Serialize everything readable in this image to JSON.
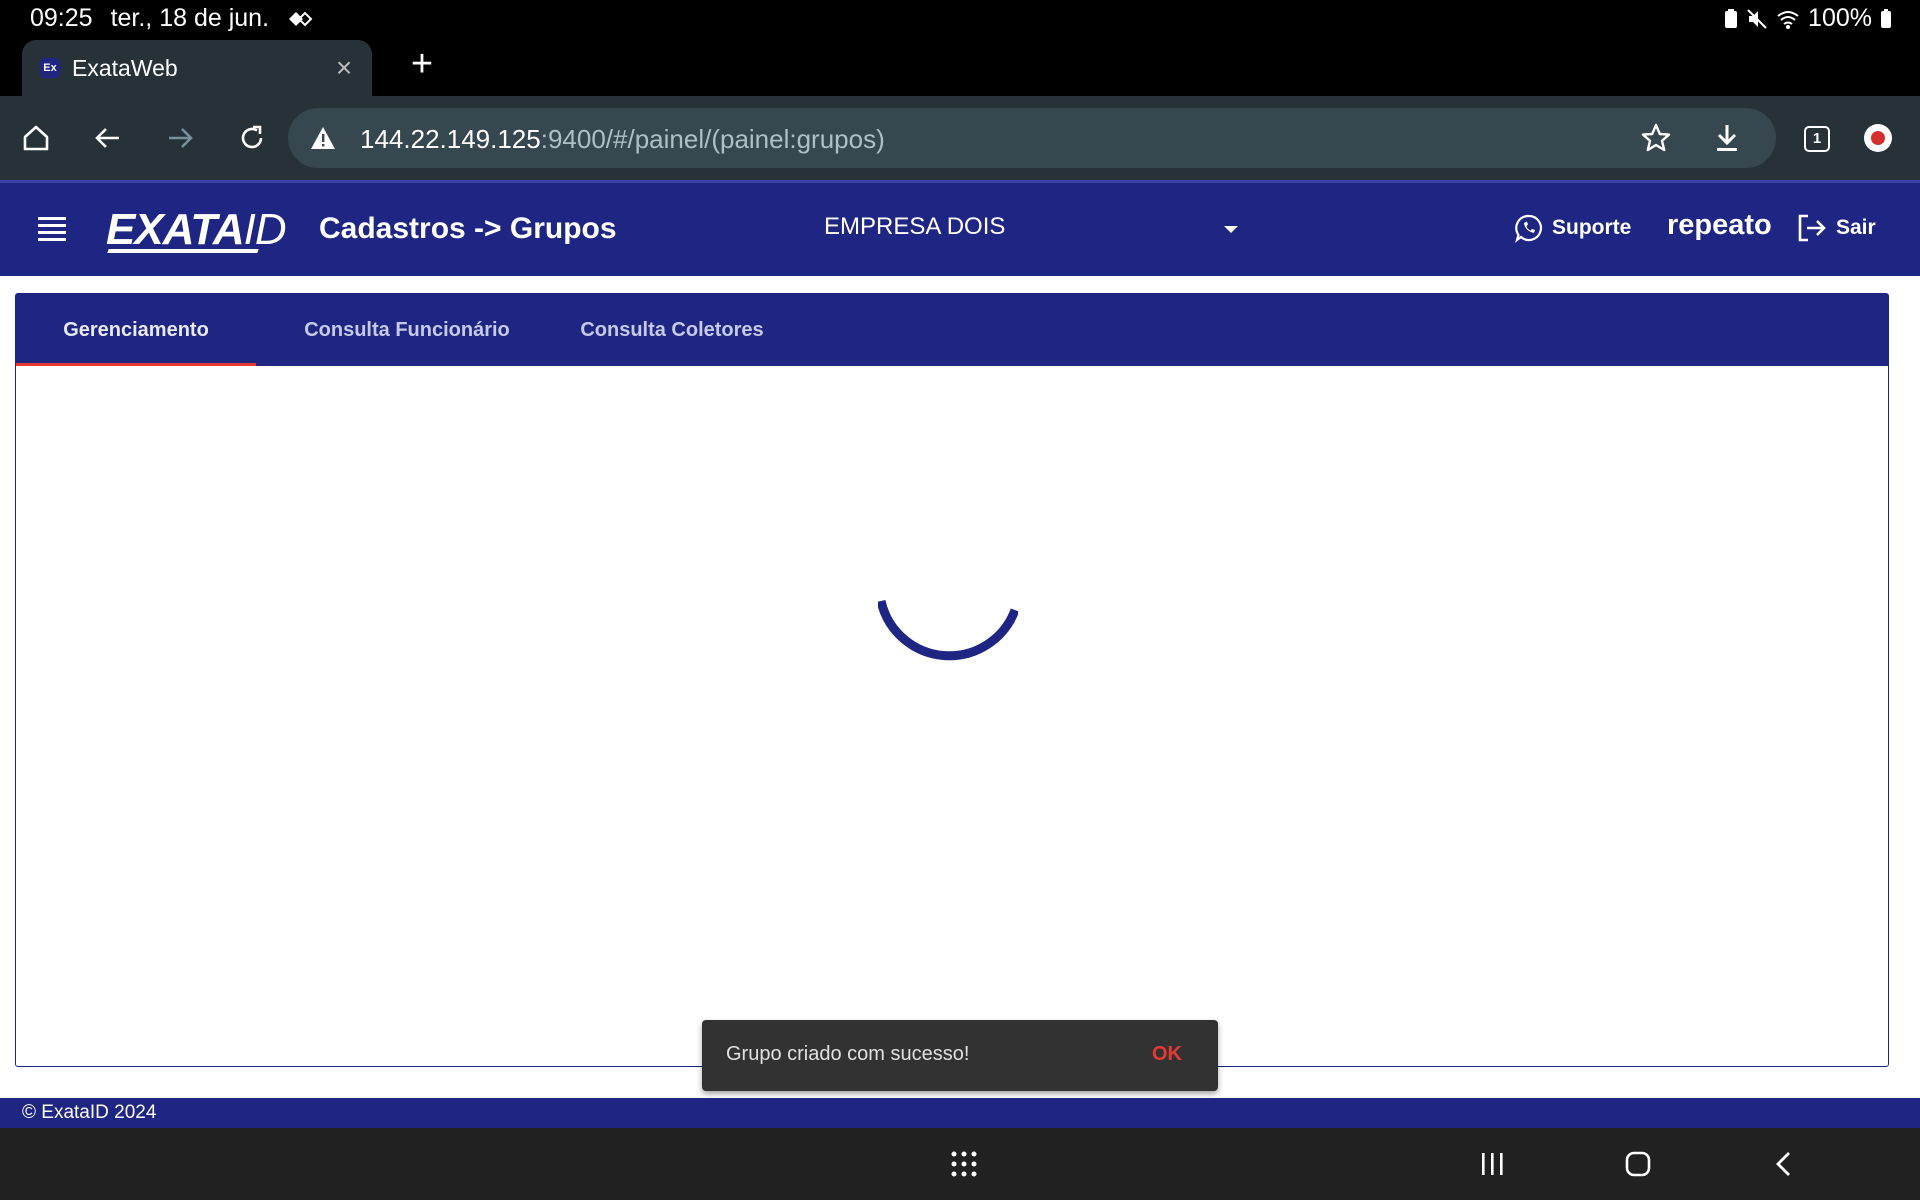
{
  "status_bar": {
    "time": "09:25",
    "date": "ter., 18 de jun.",
    "battery": "100%"
  },
  "browser": {
    "tab_title": "ExataWeb",
    "tab_favicon": "Ex",
    "url_host": "144.22.149.125",
    "url_rest": ":9400/#/painel/(painel:grupos)",
    "tab_count": "1"
  },
  "app": {
    "logo_main": "EXATA",
    "logo_suffix": "ID",
    "page_title": "Cadastros -> Grupos",
    "company": "EMPRESA DOIS",
    "support_label": "Suporte",
    "username": "repeato",
    "logout_label": "Sair",
    "tabs": [
      {
        "label": "Gerenciamento"
      },
      {
        "label": "Consulta Funcionário"
      },
      {
        "label": "Consulta Coletores"
      }
    ],
    "footer": "© ExataID 2024"
  },
  "snackbar": {
    "message": "Grupo criado com sucesso!",
    "action": "OK"
  },
  "colors": {
    "brand": "#1e2582",
    "accent": "#e53935"
  }
}
